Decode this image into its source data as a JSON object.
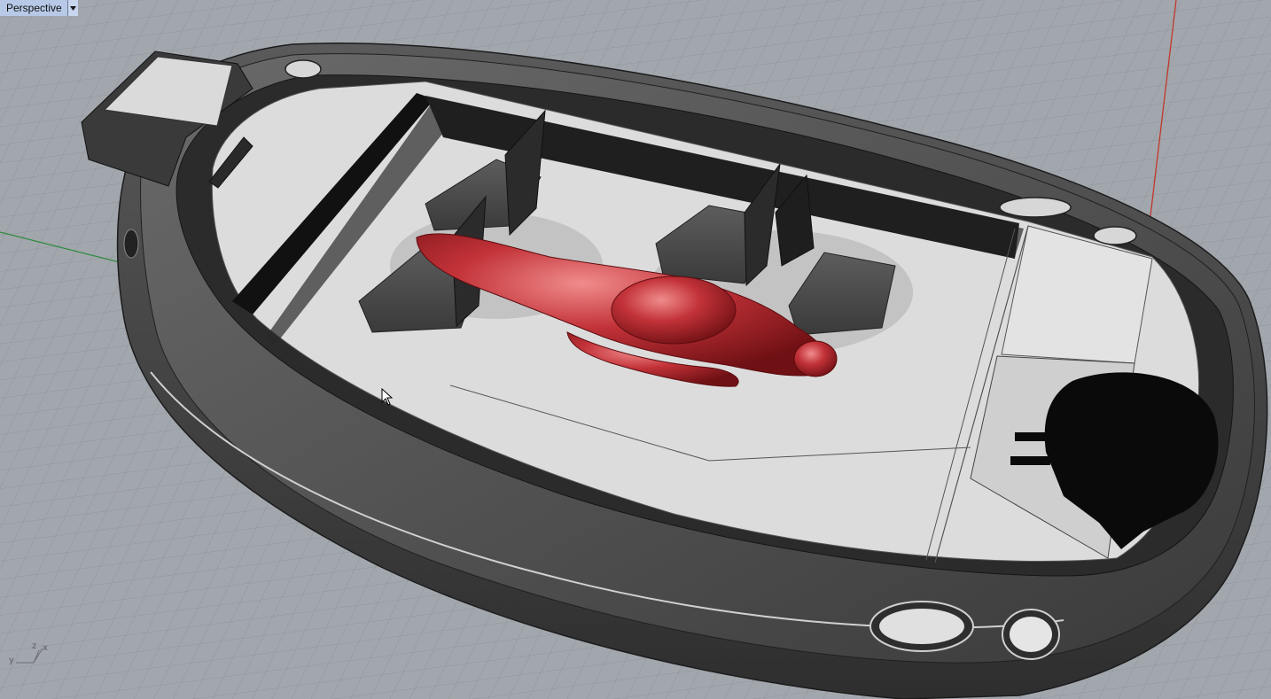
{
  "viewport": {
    "title": "Perspective",
    "menu_icon": "dropdown-arrow-icon"
  },
  "axes": {
    "y_label": "y",
    "z_label": "z",
    "x_label": "x"
  },
  "colors": {
    "grid_bg": "#a2a6ad",
    "grid_line": "#8e9298",
    "x_axis": "#c0392b",
    "y_axis": "#2e8b3e",
    "hull_dark": "#3b3b3b",
    "deck": "#d9d9d9",
    "figure": "#b8262c"
  }
}
